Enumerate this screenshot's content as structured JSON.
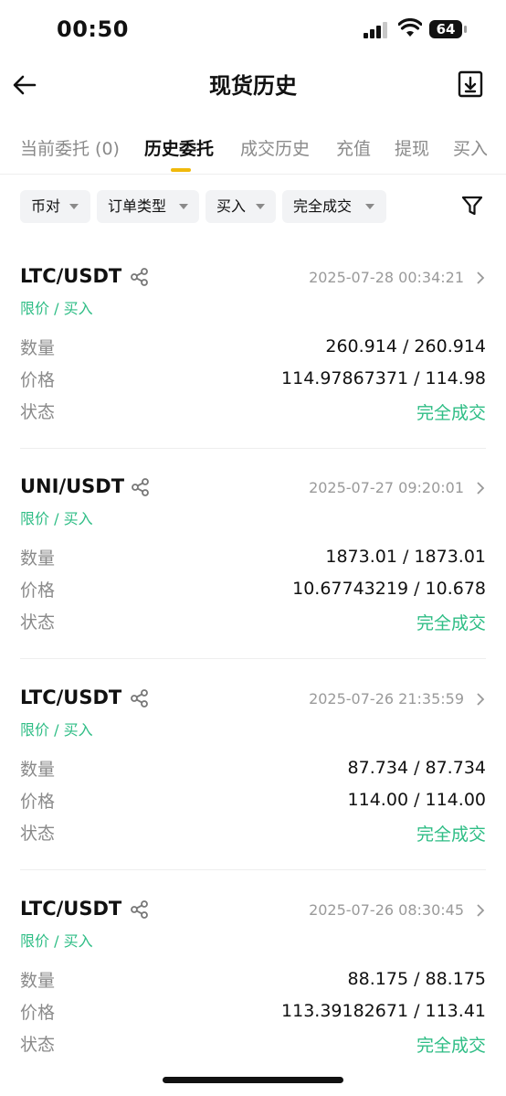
{
  "status_bar": {
    "time": "00:50",
    "battery": "64"
  },
  "header": {
    "title": "现货历史"
  },
  "tabs": [
    {
      "label": "当前委托 (0)",
      "active": false
    },
    {
      "label": "历史委托",
      "active": true
    },
    {
      "label": "成交历史",
      "active": false
    },
    {
      "label": "充值",
      "active": false
    },
    {
      "label": "提现",
      "active": false
    },
    {
      "label": "买入",
      "active": false
    }
  ],
  "filters": [
    {
      "label": "币对"
    },
    {
      "label": "订单类型"
    },
    {
      "label": "买入"
    },
    {
      "label": "完全成交"
    }
  ],
  "labels": {
    "quantity": "数量",
    "price": "价格",
    "status": "状态"
  },
  "colors": {
    "accent": "#f0b90b",
    "buy_green": "#2ebd85",
    "muted": "#8a8a8a"
  },
  "orders": [
    {
      "pair": "LTC/USDT",
      "datetime": "2025-07-28 00:34:21",
      "type": "限价 / 买入",
      "quantity": "260.914 / 260.914",
      "price": "114.97867371 / 114.98",
      "status": "完全成交"
    },
    {
      "pair": "UNI/USDT",
      "datetime": "2025-07-27 09:20:01",
      "type": "限价 / 买入",
      "quantity": "1873.01 / 1873.01",
      "price": "10.67743219 / 10.678",
      "status": "完全成交"
    },
    {
      "pair": "LTC/USDT",
      "datetime": "2025-07-26 21:35:59",
      "type": "限价 / 买入",
      "quantity": "87.734 / 87.734",
      "price": "114.00 / 114.00",
      "status": "完全成交"
    },
    {
      "pair": "LTC/USDT",
      "datetime": "2025-07-26 08:30:45",
      "type": "限价 / 买入",
      "quantity": "88.175 / 88.175",
      "price": "113.39182671 / 113.41",
      "status": "完全成交"
    }
  ]
}
